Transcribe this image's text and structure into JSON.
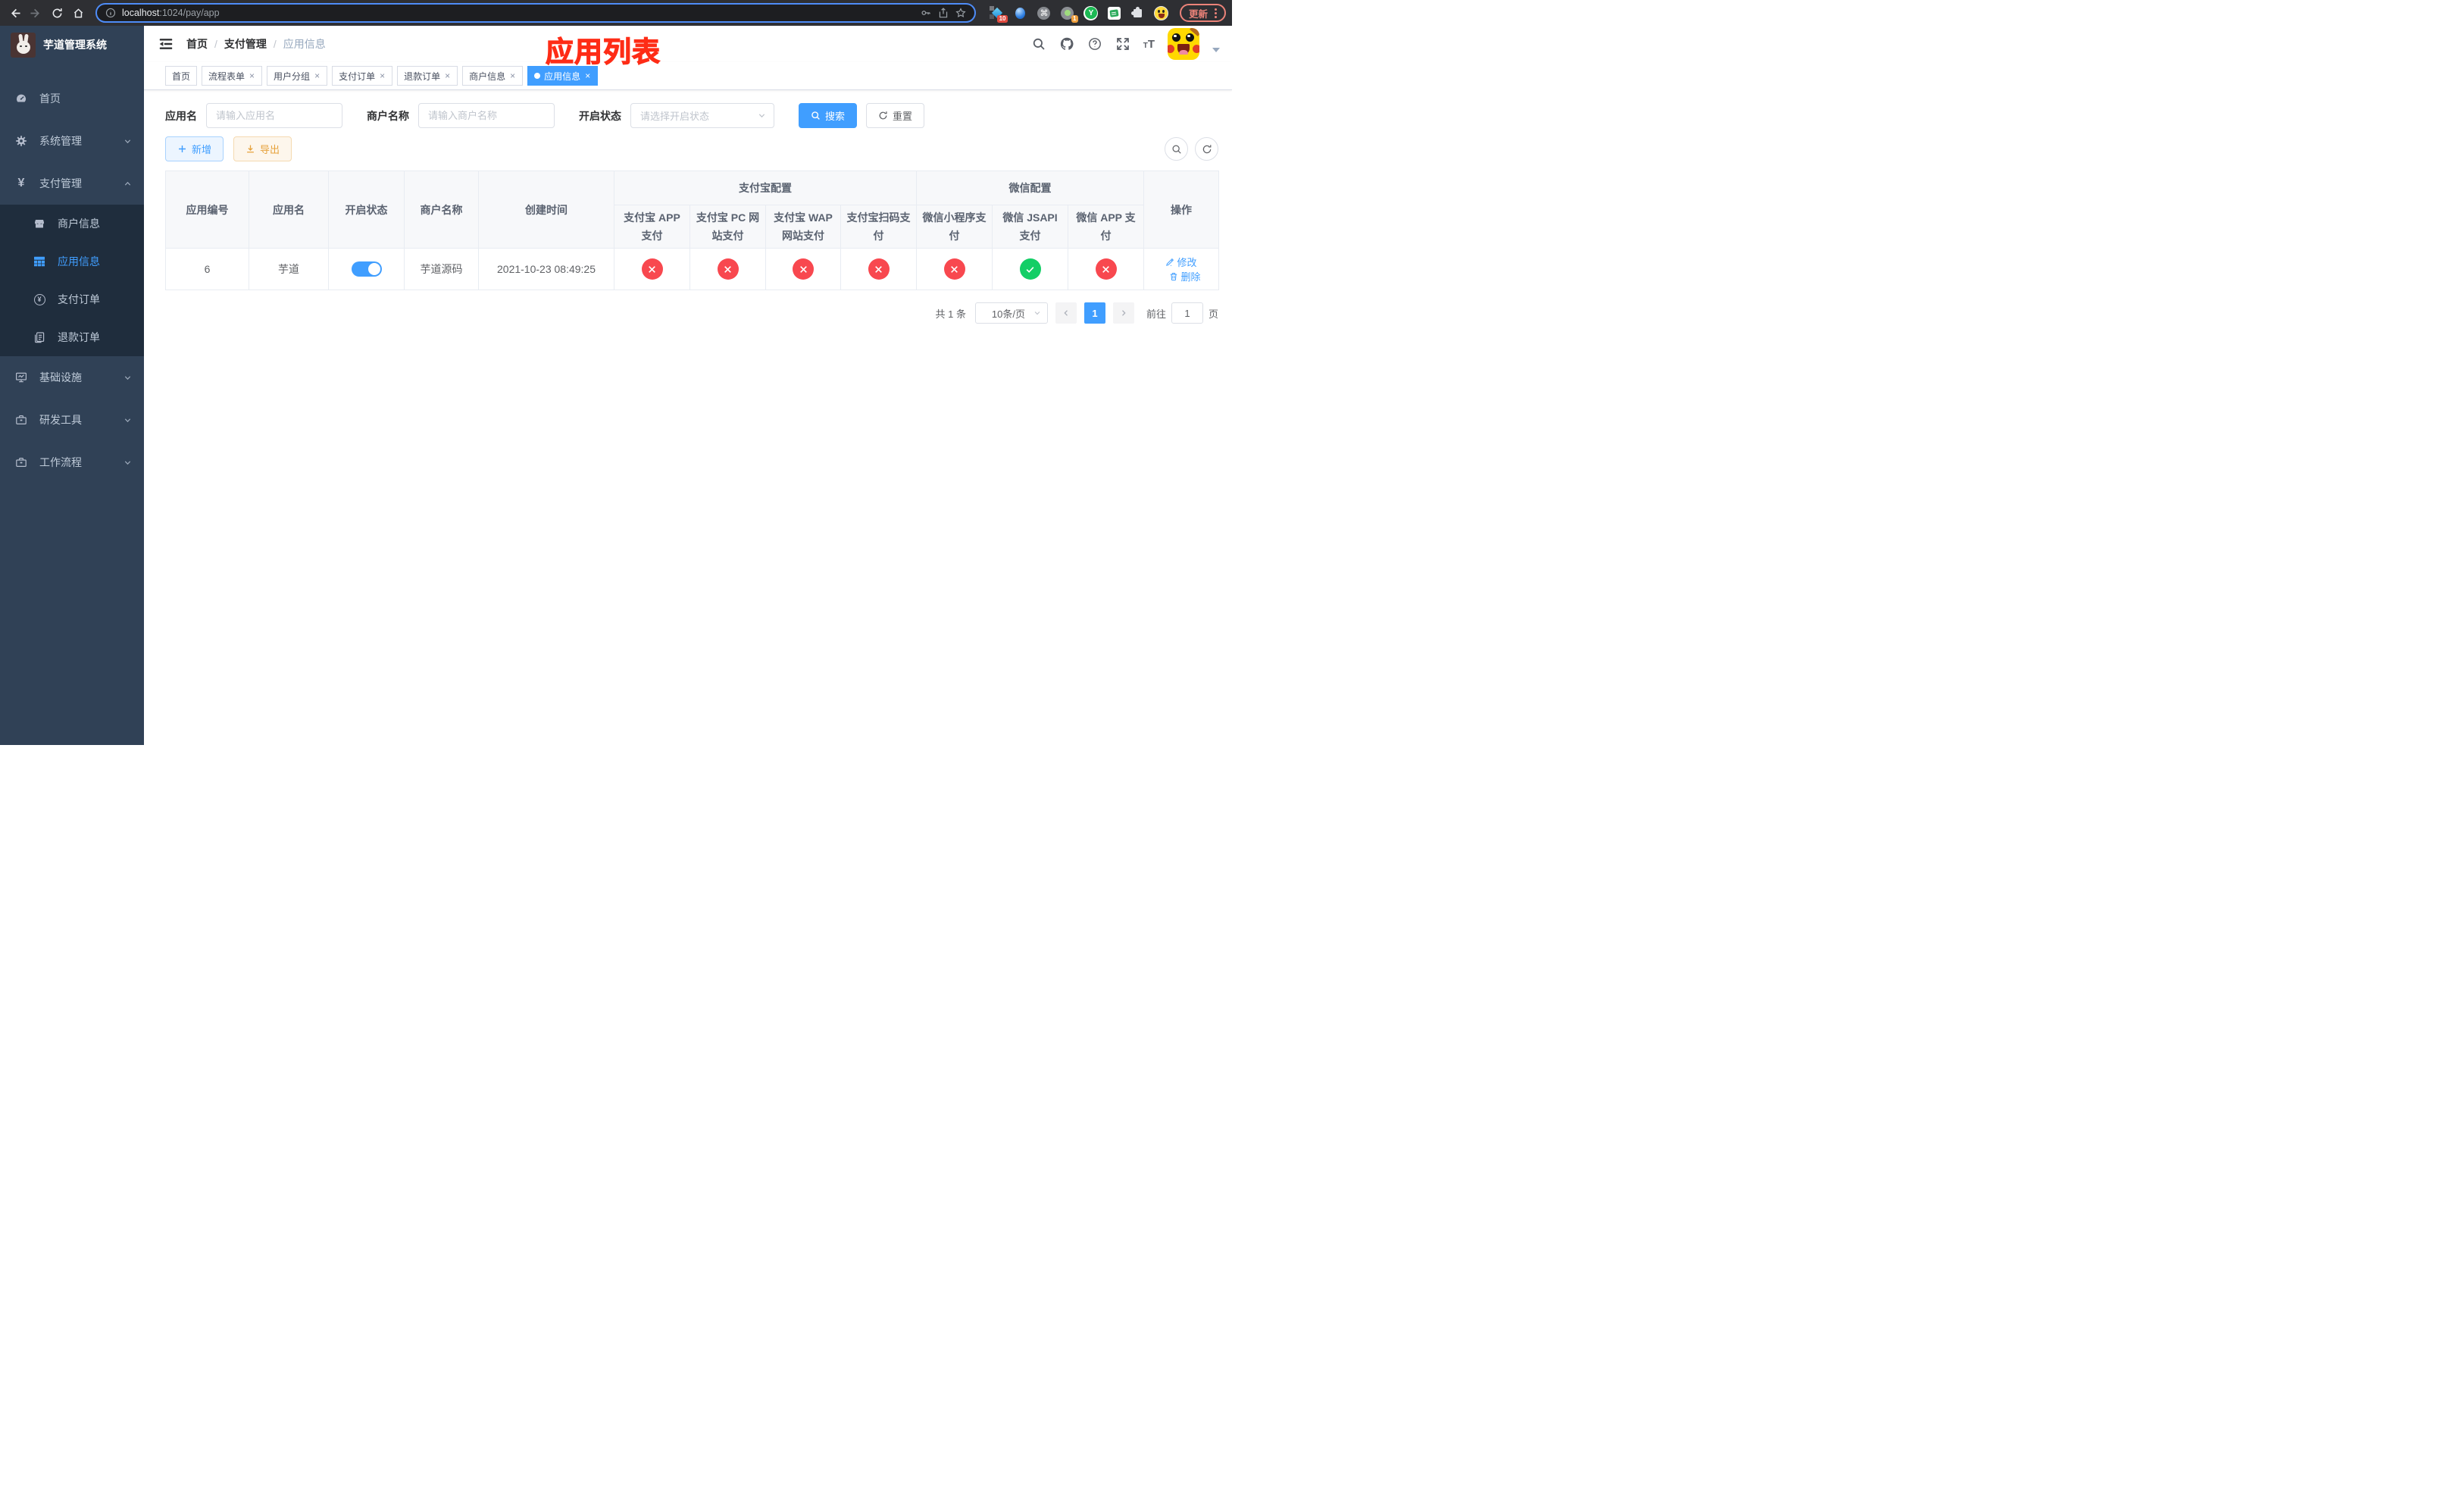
{
  "browser": {
    "url_host": "localhost",
    "url_path": ":1024/pay/app",
    "update_label": "更新",
    "ext_badge_diamond": "10",
    "ext_badge_target": "1",
    "ext_y_letter": "Y",
    "ext_cmd_glyph": "⌘"
  },
  "annotation": {
    "title": "应用列表"
  },
  "sidebar": {
    "title": "芋道管理系统",
    "menu": [
      {
        "label": "首页"
      },
      {
        "label": "系统管理"
      },
      {
        "label": "支付管理"
      },
      {
        "label": "基础设施"
      },
      {
        "label": "研发工具"
      },
      {
        "label": "工作流程"
      }
    ],
    "submenu": [
      {
        "label": "商户信息"
      },
      {
        "label": "应用信息"
      },
      {
        "label": "支付订单"
      },
      {
        "label": "退款订单"
      }
    ]
  },
  "navbar": {
    "breadcrumb": [
      "首页",
      "支付管理",
      "应用信息"
    ],
    "separator": "/"
  },
  "tabs": [
    {
      "label": "首页"
    },
    {
      "label": "流程表单"
    },
    {
      "label": "用户分组"
    },
    {
      "label": "支付订单"
    },
    {
      "label": "退款订单"
    },
    {
      "label": "商户信息"
    },
    {
      "label": "应用信息"
    }
  ],
  "filters": {
    "app_name_label": "应用名",
    "app_name_placeholder": "请输入应用名",
    "merchant_label": "商户名称",
    "merchant_placeholder": "请输入商户名称",
    "status_label": "开启状态",
    "status_placeholder": "请选择开启状态",
    "search_label": "搜索",
    "reset_label": "重置"
  },
  "toolbar": {
    "add_label": "新增",
    "export_label": "导出"
  },
  "table": {
    "columns": [
      "应用编号",
      "应用名",
      "开启状态",
      "商户名称",
      "创建时间"
    ],
    "groups": [
      {
        "label": "支付宝配置",
        "children": [
          "支付宝 APP 支付",
          "支付宝 PC 网站支付",
          "支付宝 WAP 网站支付",
          "支付宝扫码支付"
        ]
      },
      {
        "label": "微信配置",
        "children": [
          "微信小程序支付",
          "微信 JSAPI 支付",
          "微信 APP 支付"
        ]
      }
    ],
    "op_column": "操作",
    "row": {
      "id": "6",
      "name": "芋道",
      "enabled": "on",
      "merchant": "芋道源码",
      "created_at": "2021-10-23 08:49:25",
      "pay_status": [
        "no",
        "no",
        "no",
        "no",
        "no",
        "yes",
        "no"
      ],
      "edit_label": "修改",
      "delete_label": "删除"
    }
  },
  "pagination": {
    "total_text": "共 1 条",
    "page_size": "10条/页",
    "current_page": "1",
    "goto_prefix": "前往",
    "goto_value": "1",
    "goto_suffix": "页"
  },
  "colors": {
    "accent_blue": "#409eff",
    "success_green": "#13ce66",
    "danger_red": "#f8484f",
    "sidebar_bg": "#304156",
    "submenu_bg": "#1f2d3d"
  }
}
